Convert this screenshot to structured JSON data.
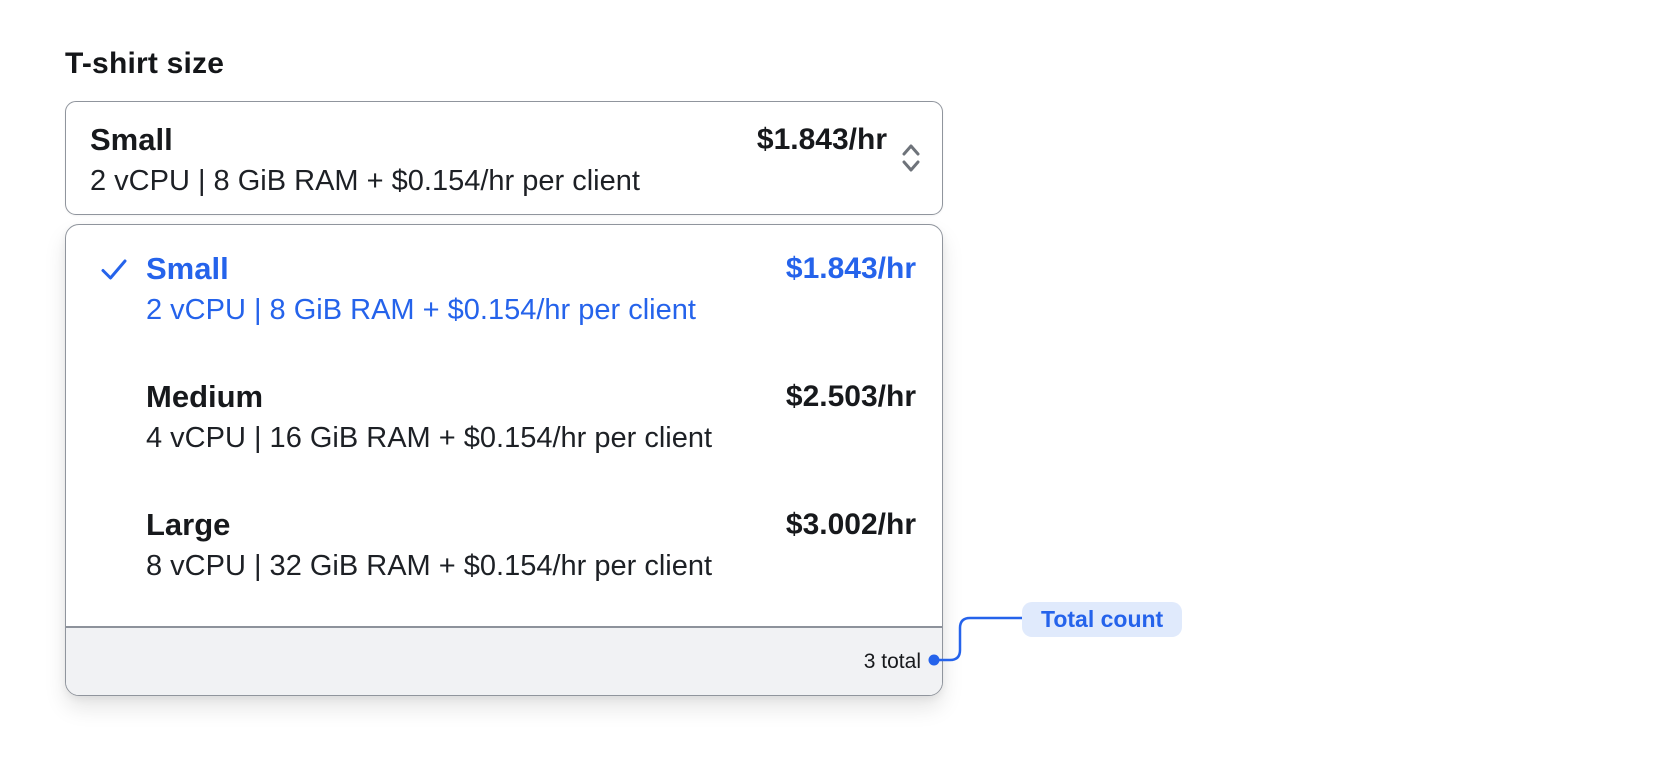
{
  "colors": {
    "accent_blue": "#2563eb",
    "annotation_pill_bg": "#e0eafc",
    "footer_bg": "#f1f2f4",
    "border_gray": "#90959d",
    "text_primary": "#17191c",
    "chevron_gray": "#6e737a"
  },
  "form": {
    "label": "T-shirt size"
  },
  "select": {
    "trigger": {
      "title": "Small",
      "specs": "2 vCPU | 8 GiB RAM + $0.154/hr per client",
      "price": "$1.843/hr",
      "icon": "chevron-up-down-icon"
    },
    "menu": {
      "options": [
        {
          "name": "Small",
          "specs": "2 vCPU | 8 GiB RAM + $0.154/hr per client",
          "price": "$1.843/hr",
          "selected": true
        },
        {
          "name": "Medium",
          "specs": "4 vCPU | 16 GiB RAM + $0.154/hr per client",
          "price": "$2.503/hr",
          "selected": false
        },
        {
          "name": "Large",
          "specs": "8 vCPU | 32 GiB RAM + $0.154/hr per client",
          "price": "$3.002/hr",
          "selected": false
        }
      ],
      "footer": {
        "total": "3 total"
      }
    }
  },
  "annotation": {
    "label": "Total count"
  }
}
